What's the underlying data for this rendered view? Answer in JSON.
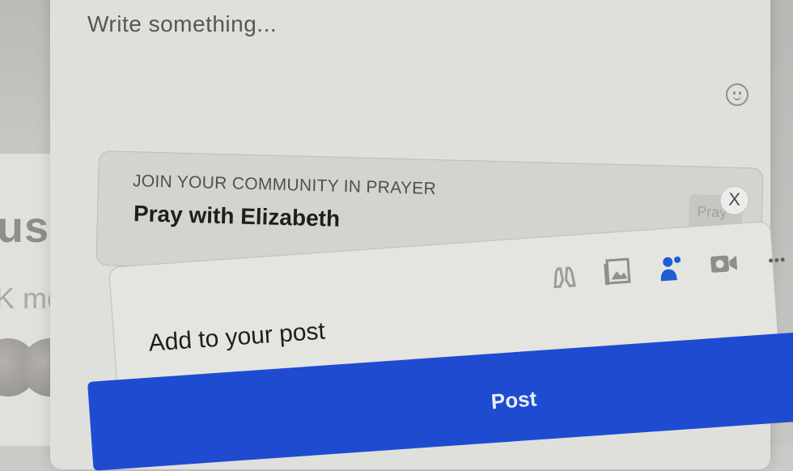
{
  "composer": {
    "placeholder": "Write something...",
    "emoji_icon": "smiley-icon"
  },
  "prayer_card": {
    "label": "JOIN YOUR COMMUNITY IN PRAYER",
    "title": "Pray with Elizabeth",
    "pray_button": "Pray",
    "close_label": "X"
  },
  "add_to_post": {
    "label": "Add to your post",
    "icons": [
      "praying-hands-icon",
      "photo-icon",
      "tag-people-icon",
      "video-icon",
      "more-icon"
    ],
    "more_label": "•••",
    "active_color": "#1f5bd6"
  },
  "post_button": {
    "label": "Post",
    "color": "#1f4bd1"
  },
  "background": {
    "text_large": "usl",
    "text_small": "K me"
  }
}
